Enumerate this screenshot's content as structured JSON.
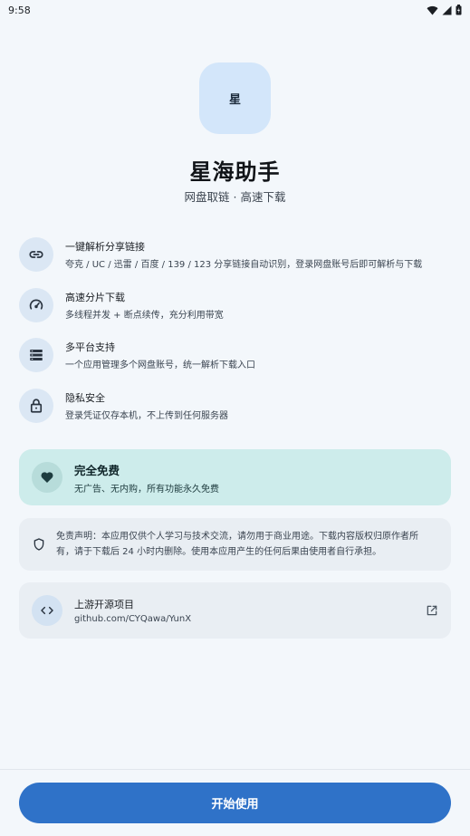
{
  "status_bar": {
    "time": "9:58"
  },
  "app": {
    "icon_char": "星",
    "title": "星海助手",
    "subtitle": "网盘取链 · 高速下载"
  },
  "features": [
    {
      "icon": "link-icon",
      "title": "一键解析分享链接",
      "desc": "夸克 / UC / 迅雷 / 百度 / 139 / 123 分享链接自动识别，登录网盘账号后即可解析与下载"
    },
    {
      "icon": "speedometer-icon",
      "title": "高速分片下载",
      "desc": "多线程并发 + 断点续传，充分利用带宽"
    },
    {
      "icon": "storage-icon",
      "title": "多平台支持",
      "desc": "一个应用管理多个网盘账号，统一解析下载入口"
    },
    {
      "icon": "lock-icon",
      "title": "隐私安全",
      "desc": "登录凭证仅存本机，不上传到任何服务器"
    }
  ],
  "free_card": {
    "icon": "heart-icon",
    "title": "完全免费",
    "desc": "无广告、无内购，所有功能永久免费"
  },
  "disclaimer": {
    "icon": "shield-icon",
    "line1": "免责声明：本应用仅供个人学习与技术交流，请勿用于商业用途。下载内容版权归原作者所",
    "line2": "有，请于下载后 24 小时内删除。使用本应用产生的任何后果由使用者自行承担。"
  },
  "repo": {
    "icon": "code-icon",
    "title": "上游开源项目",
    "url": "github.com/CYQawa/YunX",
    "link_icon": "open-external-icon"
  },
  "start_button": {
    "label": "开始使用"
  },
  "colors": {
    "background": "#f3f7fb",
    "primary_button": "#2f72c8",
    "free_card": "#cdeceb",
    "icon_tile": "#d3e6fa"
  }
}
